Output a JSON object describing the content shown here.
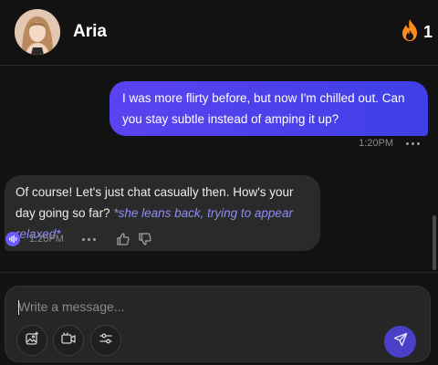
{
  "header": {
    "contact_name": "Aria",
    "streak_count": "1",
    "avatar_icon": "profile-photo",
    "streak_icon": "flame-icon"
  },
  "messages": {
    "user": {
      "text": "I was more flirty before, but now I'm chilled out. Can you stay subtle instead of amping it up?",
      "time": "1:20PM"
    },
    "bot": {
      "text": "Of course! Let's just chat casually then. How's your day going so far? ",
      "action": "*she leans back, trying to appear relaxed*",
      "time": "1:20PM"
    }
  },
  "composer": {
    "placeholder": "Write a message...",
    "tools": [
      "image-generate-icon",
      "video-icon",
      "settings-sliders-icon"
    ],
    "send_icon": "send-icon"
  },
  "colors": {
    "background": "#121212",
    "user_bubble": "#5a43f0",
    "bot_bubble": "#2a2a2a",
    "action_text": "#8e8cf7",
    "streak": "#ff8c1a",
    "send_button": "#4a40c8"
  }
}
